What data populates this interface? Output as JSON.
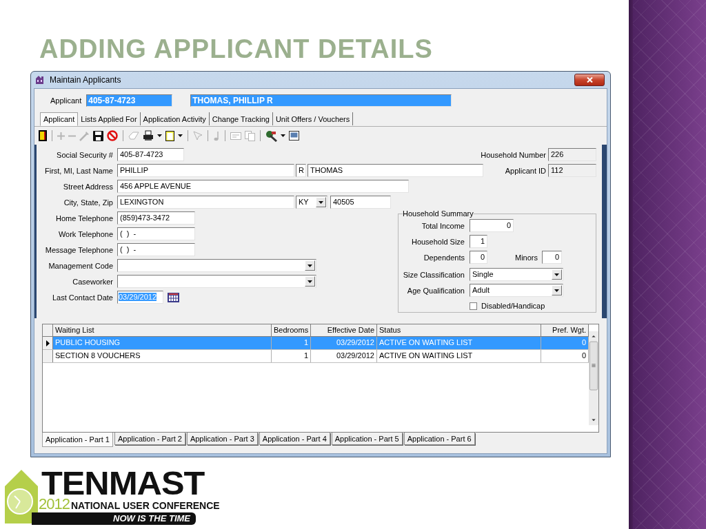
{
  "slide_title": "ADDING APPLICANT DETAILS",
  "window": {
    "title": "Maintain Applicants"
  },
  "applicant_bar": {
    "label": "Applicant",
    "id": "405-87-4723",
    "name": "THOMAS, PHILLIP R"
  },
  "tabs": [
    {
      "label": "Applicant",
      "selected": true
    },
    {
      "label": "Lists Applied For",
      "selected": false
    },
    {
      "label": "Application Activity",
      "selected": false
    },
    {
      "label": "Change Tracking",
      "selected": false
    },
    {
      "label": "Unit Offers / Vouchers",
      "selected": false
    }
  ],
  "toolbar": [
    {
      "kind": "exit",
      "disabled": false
    },
    {
      "kind": "separator"
    },
    {
      "kind": "add",
      "disabled": true
    },
    {
      "kind": "remove",
      "disabled": true
    },
    {
      "kind": "edit",
      "disabled": true
    },
    {
      "kind": "save",
      "disabled": false
    },
    {
      "kind": "cancel",
      "disabled": false
    },
    {
      "kind": "separator"
    },
    {
      "kind": "erase",
      "disabled": true
    },
    {
      "kind": "print",
      "disabled": false
    },
    {
      "kind": "dropdown",
      "disabled": false
    },
    {
      "kind": "new",
      "disabled": false
    },
    {
      "kind": "dropdown",
      "disabled": false
    },
    {
      "kind": "separator"
    },
    {
      "kind": "pointer",
      "disabled": true
    },
    {
      "kind": "separator"
    },
    {
      "kind": "note",
      "disabled": true
    },
    {
      "kind": "separator"
    },
    {
      "kind": "card",
      "disabled": true
    },
    {
      "kind": "copy",
      "disabled": true
    },
    {
      "kind": "separator"
    },
    {
      "kind": "tools",
      "disabled": false
    },
    {
      "kind": "dropdown",
      "disabled": false
    },
    {
      "kind": "picture",
      "disabled": false
    }
  ],
  "form": {
    "social_security": {
      "label": "Social Security #",
      "value": "405-87-4723"
    },
    "household_number": {
      "label": "Household Number",
      "value": "226",
      "disabled": true
    },
    "name": {
      "label": "First, MI, Last Name",
      "first": "PHILLIP",
      "middle": "R",
      "last": "THOMAS"
    },
    "applicant_id": {
      "label": "Applicant ID",
      "value": "112",
      "disabled": true
    },
    "street": {
      "label": "Street Address",
      "value": "456 APPLE AVENUE"
    },
    "city_state_zip": {
      "label": "City, State, Zip",
      "city": "LEXINGTON",
      "state": "KY",
      "zip": "40505"
    },
    "home_telephone": {
      "label": "Home Telephone",
      "value": "(859)473-3472"
    },
    "work_telephone": {
      "label": "Work Telephone",
      "value": "(  )  -"
    },
    "message_telephone": {
      "label": "Message Telephone",
      "value": "(  )  -"
    },
    "management_code": {
      "label": "Management Code"
    },
    "caseworker": {
      "label": "Caseworker"
    },
    "last_contact_date": {
      "label": "Last Contact Date",
      "value": "03/29/2012",
      "text_selected": true
    }
  },
  "household_summary": {
    "title": "Household Summary",
    "total_income": {
      "label": "Total Income",
      "value": "0"
    },
    "household_size": {
      "label": "Household Size",
      "value": "1"
    },
    "dependents": {
      "label": "Dependents",
      "value": "0"
    },
    "minors": {
      "label": "Minors",
      "value": "0"
    },
    "size_classification": {
      "label": "Size Classification",
      "value": "Single"
    },
    "age_qualification": {
      "label": "Age Qualification",
      "value": "Adult"
    },
    "disabled_handicap": {
      "label": "Disabled/Handicap",
      "checked": false
    }
  },
  "table": {
    "columns": [
      "Waiting List",
      "Bedrooms",
      "Effective Date",
      "Status",
      "Pref. Wgt."
    ],
    "rows": [
      {
        "cells": [
          "PUBLIC HOUSING",
          "1",
          "03/29/2012",
          "ACTIVE ON WAITING LIST",
          "0"
        ],
        "selected": true
      },
      {
        "cells": [
          "SECTION 8 VOUCHERS",
          "1",
          "03/29/2012",
          "ACTIVE ON WAITING LIST",
          "0"
        ],
        "selected": false
      }
    ]
  },
  "bottom_tabs": [
    {
      "label": "Application - Part 1",
      "selected": true
    },
    {
      "label": "Application - Part 2",
      "selected": false
    },
    {
      "label": "Application - Part 3",
      "selected": false
    },
    {
      "label": "Application - Part 4",
      "selected": false
    },
    {
      "label": "Application - Part 5",
      "selected": false
    },
    {
      "label": "Application - Part 6",
      "selected": false
    }
  ],
  "logo": {
    "name": "TENMAST",
    "year": "2012",
    "subtitle": "NATIONAL USER CONFERENCE",
    "tagline": "NOW IS THE TIME"
  }
}
